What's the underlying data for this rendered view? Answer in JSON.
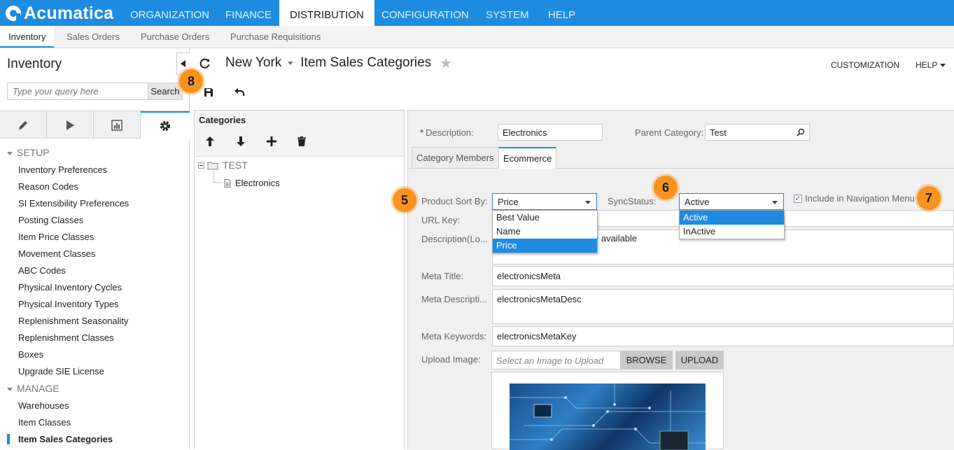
{
  "app": {
    "logo_text": "Acumatica"
  },
  "top_nav": [
    "ORGANIZATION",
    "FINANCE",
    "DISTRIBUTION",
    "CONFIGURATION",
    "SYSTEM",
    "HELP"
  ],
  "sub_nav": [
    "Inventory",
    "Sales Orders",
    "Purchase Orders",
    "Purchase Requisitions"
  ],
  "sidebar": {
    "title": "Inventory",
    "search_placeholder": "Type your query here",
    "search_button": "Search",
    "sections": [
      {
        "label": "SETUP",
        "items": [
          "Inventory Preferences",
          "Reason Codes",
          "SI Extensibility Preferences",
          "Posting Classes",
          "Item Price Classes",
          "Movement Classes",
          "ABC Codes",
          "Physical Inventory Cycles",
          "Physical Inventory Types",
          "Replenishment Seasonality",
          "Replenishment Classes",
          "Boxes",
          "Upgrade SIE License"
        ]
      },
      {
        "label": "MANAGE",
        "items": [
          "Warehouses",
          "Item Classes",
          "Item Sales Categories"
        ]
      }
    ]
  },
  "header": {
    "branch": "New York",
    "screen_title": "Item Sales Categories",
    "customization": "CUSTOMIZATION",
    "help": "HELP"
  },
  "categories": {
    "title": "Categories",
    "tree_root": "TEST",
    "tree_child": "Electronics"
  },
  "form": {
    "description_label": "Description:",
    "description_required": "*",
    "description_value": "Electronics",
    "parent_label": "Parent Category:",
    "parent_value": "Test",
    "tabs": [
      "Category Members",
      "Ecommerce"
    ],
    "sort_label": "Product Sort By:",
    "sort_value": "Price",
    "sort_options": [
      "Best Value",
      "Name",
      "Price"
    ],
    "sync_label": "SyncStatus:",
    "sync_value": "Active",
    "sync_options": [
      "Active",
      "InActive"
    ],
    "include_nav_label": "Include in Navigation Menu",
    "include_nav_checked": true,
    "url_key_label": "URL Key:",
    "desc_local_label": "Description(Lo...",
    "desc_local_value": "e available",
    "meta_title_label": "Meta Title:",
    "meta_title_value": "electronicsMeta",
    "meta_desc_label": "Meta Descripti...",
    "meta_desc_value": "electronicsMetaDesc",
    "meta_keywords_label": "Meta Keywords:",
    "meta_keywords_value": "electronicsMetaKey",
    "upload_label": "Upload Image:",
    "upload_placeholder": "Select an Image to Upload",
    "browse_button": "BROWSE",
    "upload_button": "UPLOAD"
  },
  "callouts": [
    "8",
    "5",
    "6",
    "7"
  ],
  "colors": {
    "brand": "#1d8ce0",
    "callout": "#f7931e",
    "selection": "#1d8ce0"
  }
}
